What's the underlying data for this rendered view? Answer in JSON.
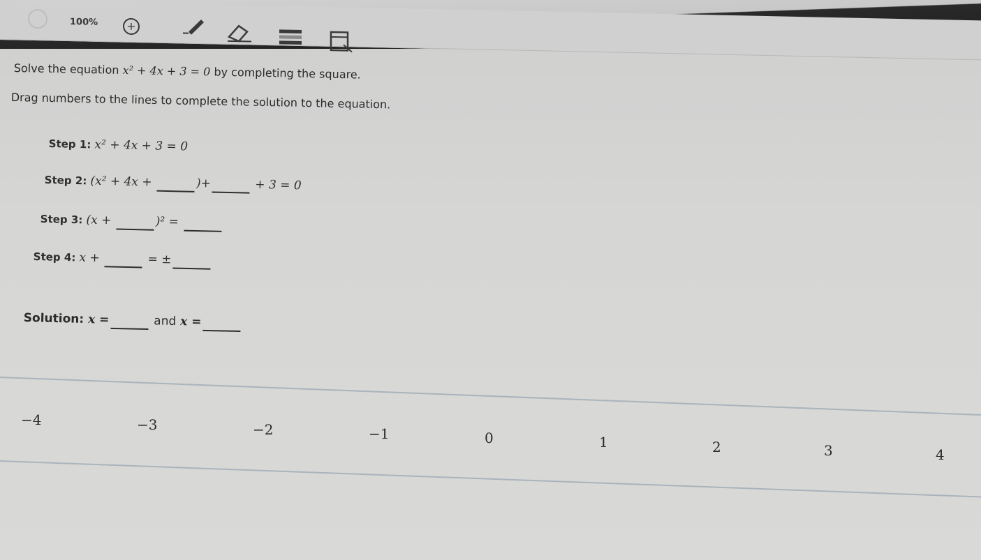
{
  "toolbar": {
    "zoom": "100%",
    "zoom_in_symbol": "+",
    "icons": [
      "back-icon",
      "zoom-in-icon",
      "pencil-icon",
      "eraser-icon",
      "line-reader-icon",
      "calculator-icon"
    ]
  },
  "question": {
    "prefix": "Solve the equation",
    "equation": "x² + 4x + 3 = 0",
    "suffix": "by completing the square."
  },
  "instructions": "Drag numbers to the lines to complete the solution to the equation.",
  "steps": [
    {
      "label": "Step 1:",
      "parts": [
        "x² + 4x + 3 = 0"
      ]
    },
    {
      "label": "Step 2:",
      "parts": [
        "(x² + 4x + ",
        ")+",
        " + 3 = 0"
      ]
    },
    {
      "label": "Step 3:",
      "parts": [
        "(x + ",
        ")² = ",
        ""
      ]
    },
    {
      "label": "Step 4:",
      "parts": [
        "x + ",
        " = ±",
        ""
      ]
    }
  ],
  "solution": {
    "label": "Solution:",
    "x1": "x =",
    "and": "and",
    "x2": "x ="
  },
  "number_tiles": [
    "−4",
    "−3",
    "−2",
    "−1",
    "0",
    "1",
    "2",
    "3",
    "4"
  ]
}
